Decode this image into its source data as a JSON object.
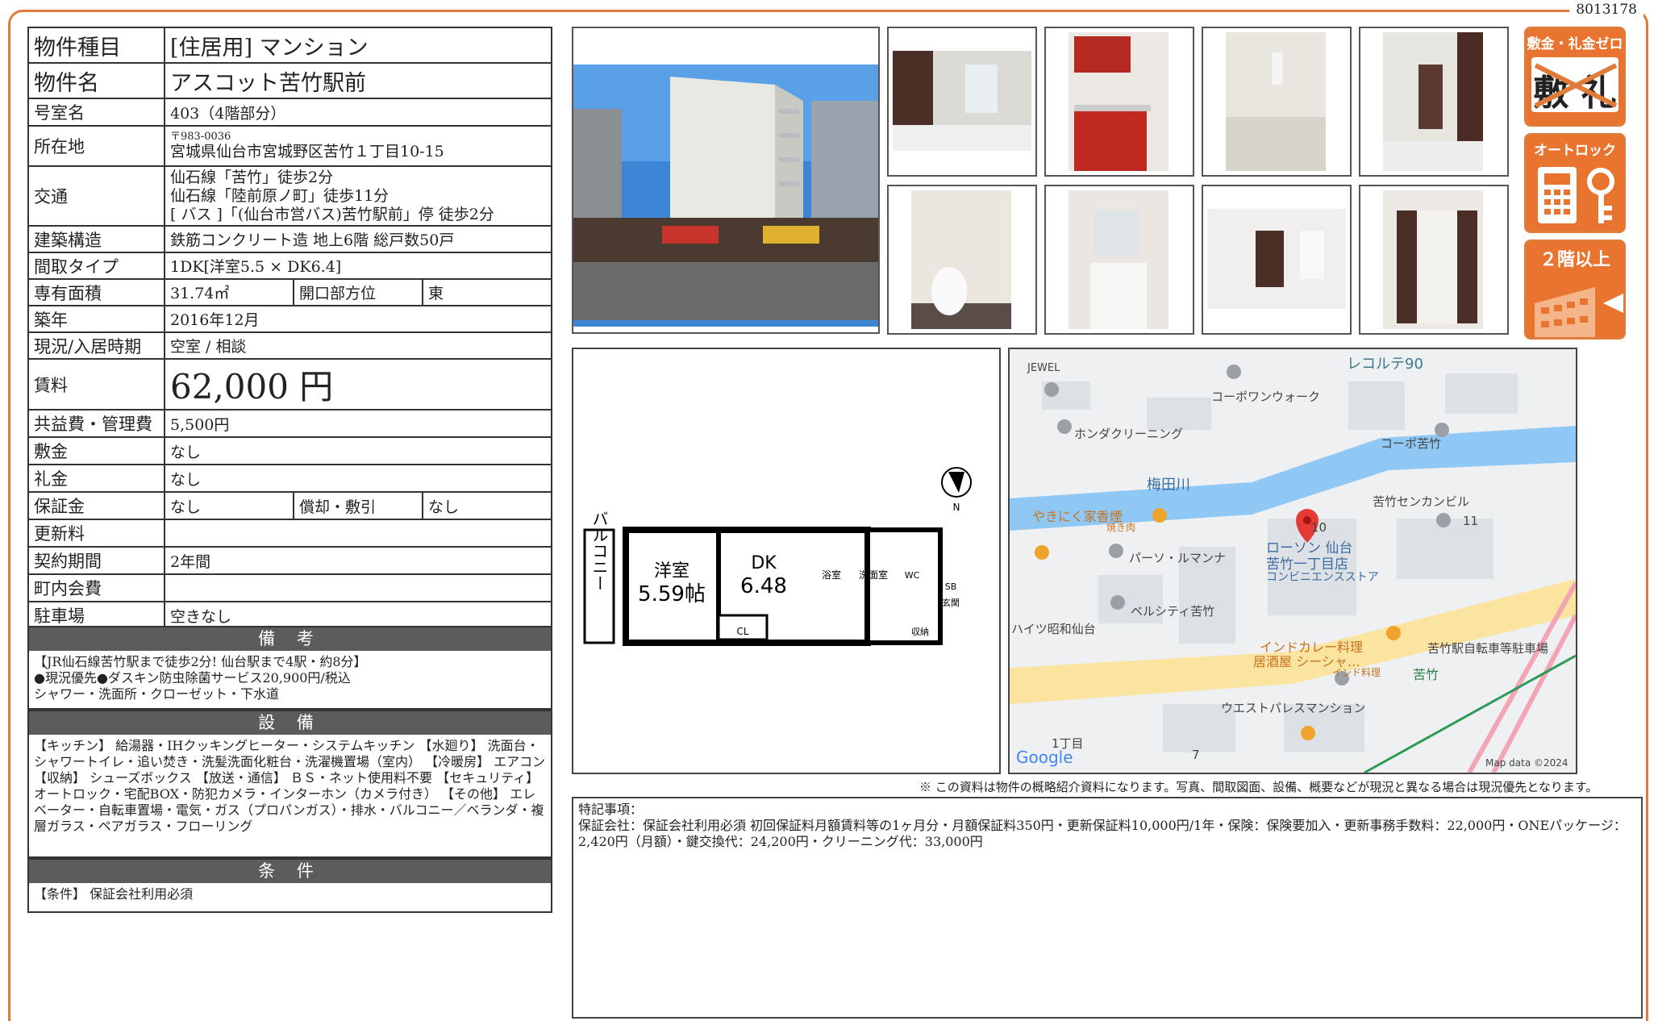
{
  "doc_code": "8013178",
  "info": {
    "type_label": "物件種目",
    "type_value": "[住居用] マンション",
    "name_label": "物件名",
    "name_value": "アスコット苦竹駅前",
    "room_label": "号室名",
    "room_value": "403（4階部分）",
    "addr_label": "所在地",
    "postal": "〒983-0036",
    "address": "宮城県仙台市宮城野区苦竹１丁目10-15",
    "traffic_label": "交通",
    "traffic": [
      "仙石線「苦竹」徒歩2分",
      "仙石線「陸前原ノ町」徒歩11分",
      "[ バス ]「(仙台市営バス)苦竹駅前」停 徒歩2分"
    ],
    "structure_label": "建築構造",
    "structure_value": "鉄筋コンクリート造 地上6階 総戸数50戸",
    "layout_label": "間取タイプ",
    "layout_value": "1DK[洋室5.5 × DK6.4]",
    "area_label": "専有面積",
    "area_value": "31.74㎡",
    "direction_label": "開口部方位",
    "direction_value": "東",
    "built_label": "築年",
    "built_value": "2016年12月",
    "status_label": "現況/入居時期",
    "status_value": "空室 / 相談",
    "rent_label": "賃料",
    "rent_value": "62,000 円",
    "fee_label": "共益費・管理費",
    "fee_value": "5,500円",
    "deposit_label": "敷金",
    "deposit_value": "なし",
    "key_label": "礼金",
    "key_value": "なし",
    "guarantee_label": "保証金",
    "guarantee_value": "なし",
    "amort_label": "償却・敷引",
    "amort_value": "なし",
    "renewal_label": "更新料",
    "renewal_value": "",
    "contract_label": "契約期間",
    "contract_value": "2年間",
    "assoc_label": "町内会費",
    "assoc_value": "",
    "parking_label": "駐車場",
    "parking_value": "空きなし"
  },
  "remarks": {
    "title": "備 考",
    "text": "【JR仙石線苦竹駅まで徒歩2分! 仙台駅まで4駅・約8分】\n●現況優先●ダスキン防虫除菌サービス20,900円/税込\nシャワー・洗面所・クローゼット・下水道"
  },
  "equipment": {
    "title": "設 備",
    "text": "【キッチン】 給湯器・IHクッキングヒーター・システムキッチン 【水廻り】 洗面台・シャワートイレ・追い焚き・洗髪洗面化粧台・洗濯機置場（室内） 【冷暖房】 エアコン 【収納】 シューズボックス 【放送・通信】 ＢＳ・ネット使用料不要 【セキュリティ】 オートロック・宅配BOX・防犯カメラ・インターホン（カメラ付き） 【その他】 エレベーター・自転車置場・電気・ガス（プロパンガス）・排水・バルコニー／ベランダ・複層ガラス・ペアガラス・フローリング"
  },
  "conditions": {
    "title": "条 件",
    "text": "【条件】 保証会社利用必須"
  },
  "badges": [
    "敷金・礼金ゼロ",
    "オートロック",
    "２階以上"
  ],
  "badge_strike": "敷 礼",
  "floorplan": {
    "balcony": "バルコニー",
    "room1": "洋室",
    "room1_size": "5.59帖",
    "room2": "DK",
    "room2_size": "6.48",
    "bath": "浴室",
    "wash": "洗面室",
    "wc": "WC",
    "sb": "SB",
    "entrance": "玄関",
    "cl": "CL",
    "storage": "収納",
    "north": "N"
  },
  "map": {
    "labels": [
      "JEWEL",
      "レコルテ90",
      "コーポワンウォーク",
      "ホンダクリーニング",
      "コーポ苦竹",
      "梅田川",
      "苦竹センカンビル",
      "やきにく家香煙",
      "焼き肉",
      "10",
      "11",
      "ローソン 仙台",
      "苦竹一丁目店",
      "コンビニエンスストア",
      "パーソ・ルマンナ",
      "ハイツ昭和仙台",
      "ベルシティ苦竹",
      "インドカレー料理",
      "居酒屋 シーシャ…",
      "インド料理",
      "苦竹駅自転車等駐車場",
      "苦竹",
      "ウエストパレスマンション",
      "1丁目",
      "7",
      "Google",
      "Map data ©2024"
    ]
  },
  "note": "※ この資料は物件の概略紹介資料になります。写真、間取図面、設備、概要などが現況と異なる場合は現況優先となります。",
  "special": {
    "title": "特記事項：",
    "text": "保証会社：保証会社利用必須 初回保証料月額賃料等の1ヶ月分・月額保証料350円・更新保証料10,000円/1年・保険：保険要加入・更新事務手数料：22,000円・ONEパッケージ：2,420円（月額）・鍵交換代：24,200円・クリーニング代：33,000円"
  }
}
